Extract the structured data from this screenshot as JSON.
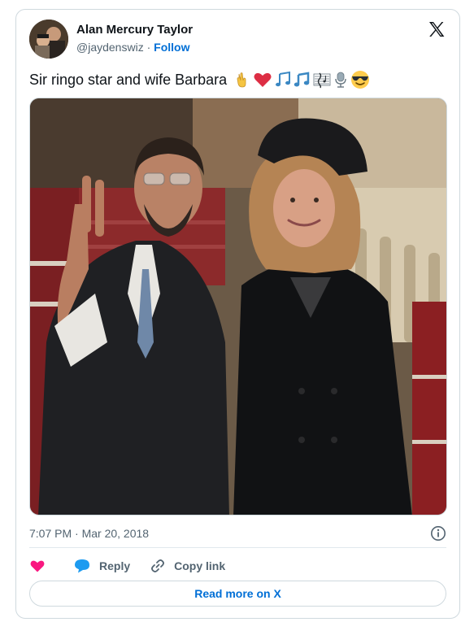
{
  "author": {
    "name": "Alan Mercury Taylor",
    "handle": "@jaydenswiz",
    "separator": "·",
    "follow_label": "Follow"
  },
  "tweet": {
    "text": "Sir ringo star and wife Barbara",
    "emojis": [
      "victory-hand",
      "red-heart",
      "musical-notes",
      "musical-note",
      "musical-score",
      "microphone",
      "sunglasses-face"
    ],
    "timestamp": "7:07 PM · Mar 20, 2018"
  },
  "actions": {
    "reply_label": "Reply",
    "copy_link_label": "Copy link"
  },
  "footer": {
    "read_more_label": "Read more on X"
  },
  "colors": {
    "accent": "#006fd6",
    "heart": "#f91880",
    "reply_bubble": "#1d9bf0",
    "secondary_text": "#536471"
  }
}
